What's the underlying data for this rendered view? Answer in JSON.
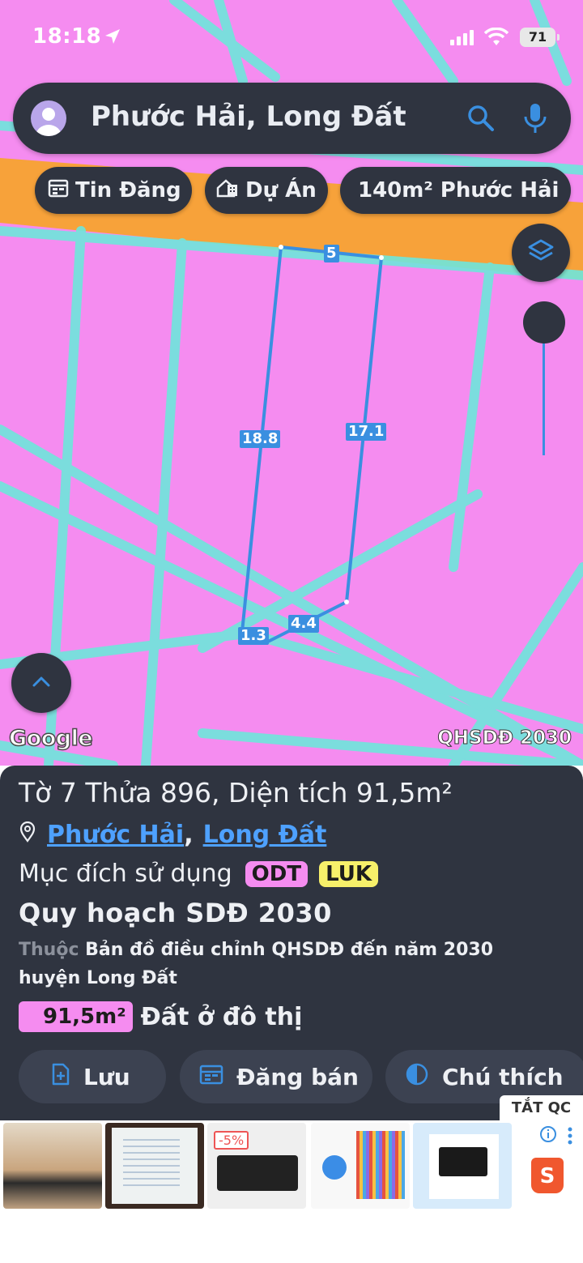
{
  "status_bar": {
    "time": "18:18",
    "battery": "71"
  },
  "search": {
    "query": "Phước Hải, Long Đất"
  },
  "chips": [
    {
      "label": "Tin Đăng",
      "icon": "calendar-icon"
    },
    {
      "label": "Dự Án",
      "icon": "building-icon"
    },
    {
      "label": "140m² Phước Hải"
    }
  ],
  "map": {
    "plot_dimensions": [
      "5",
      "18.8",
      "17.1",
      "4.4",
      "1.3"
    ],
    "google_logo": "Google",
    "source_label": "QHSDĐ 2030",
    "colors": {
      "land": "#f58cf0",
      "road": "#f7a23a",
      "boundary": "#6ee6dc",
      "plot_outline": "#3a8fe0"
    }
  },
  "panel": {
    "title": "Tờ 7 Thửa 896, Diện tích 91,5m²",
    "ward": "Phước Hải",
    "separator": ",",
    "district": "Long Đất",
    "purpose_label": "Mục đích sử dụng",
    "purpose_codes": [
      "ODT",
      "LUK"
    ],
    "plan_title": "Quy hoạch SDĐ 2030",
    "desc_prefix": "Thuộc",
    "desc_text": " Bản đồ điều chỉnh QHSDĐ đến năm 2030 huyện Long Đất",
    "area_value": "91,5m²",
    "area_type": "Đất ở đô thị",
    "buttons": {
      "save": "Lưu",
      "post": "Đăng bán",
      "legend": "Chú thích"
    }
  },
  "ads": {
    "close_label": "TẮT QC",
    "discount": "-5%"
  }
}
